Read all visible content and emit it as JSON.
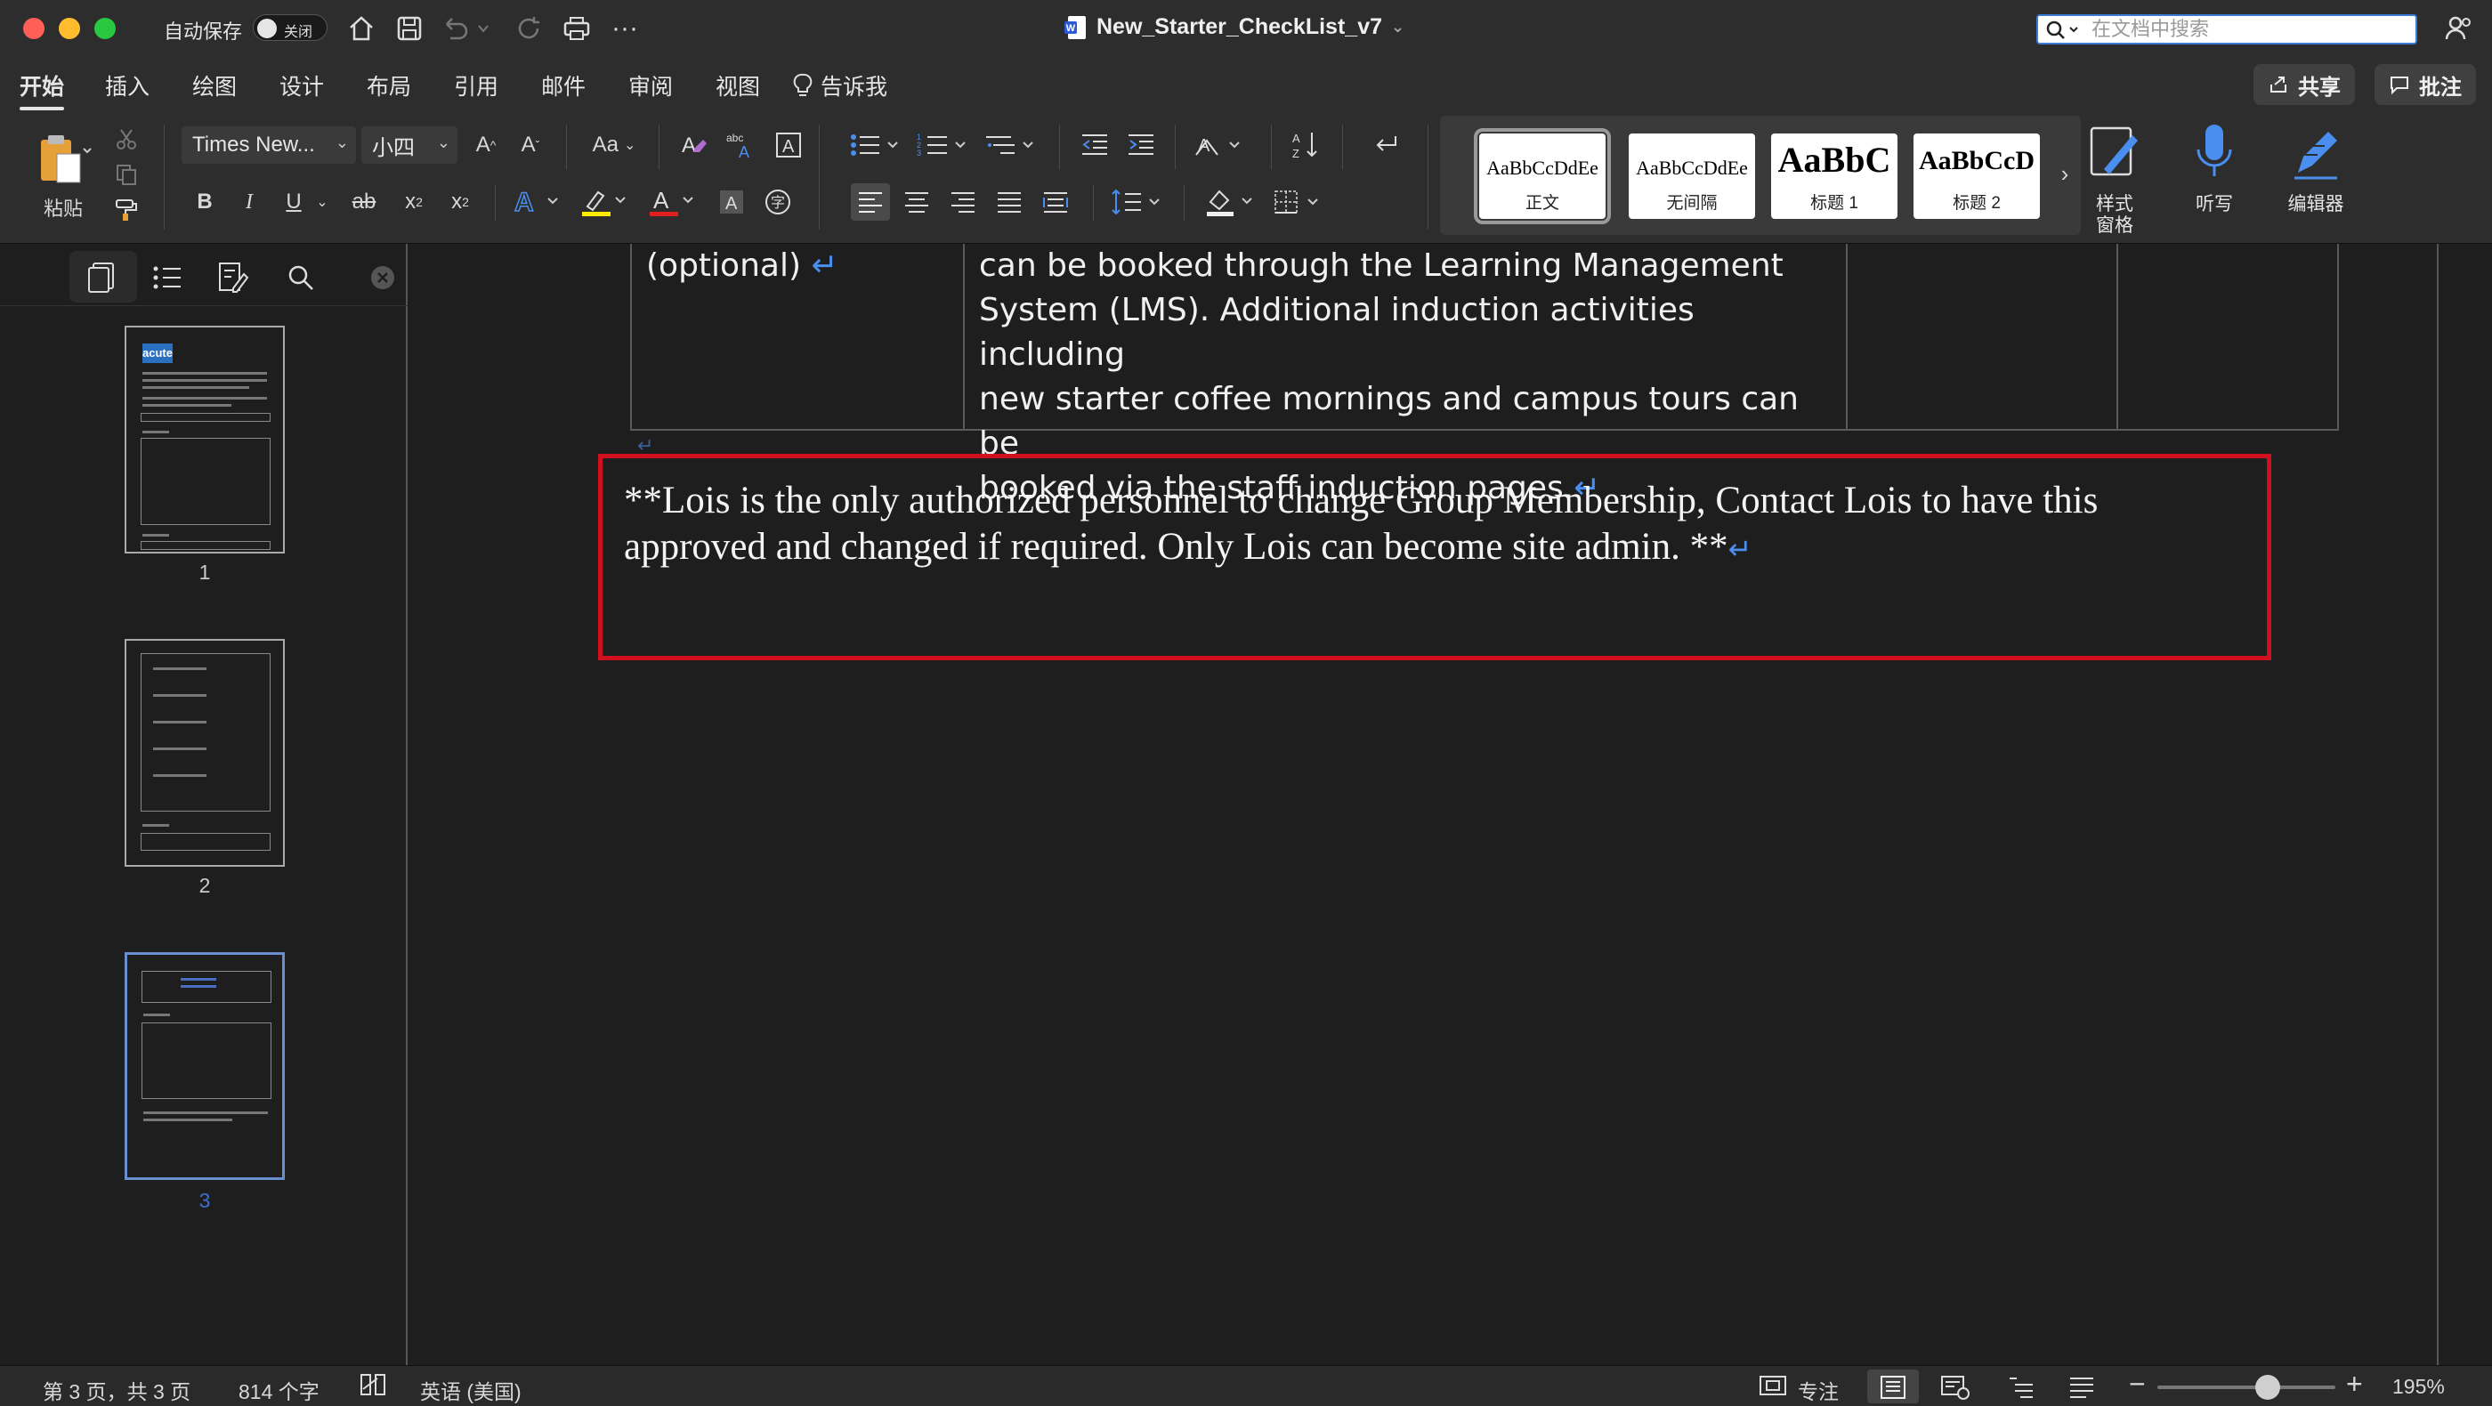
{
  "window": {
    "autosave_label": "自动保存",
    "autosave_state": "关闭",
    "doc_title": "New_Starter_CheckList_v7",
    "search_placeholder": "在文档中搜索"
  },
  "ribbon_tabs": [
    "开始",
    "插入",
    "绘图",
    "设计",
    "布局",
    "引用",
    "邮件",
    "审阅",
    "视图"
  ],
  "tell_me": "告诉我",
  "share_label": "共享",
  "comments_label": "批注",
  "ribbon": {
    "paste_label": "粘贴",
    "font_name": "Times New...",
    "font_size": "小四",
    "change_case": "Aa",
    "styles": [
      {
        "preview": "AaBbCcDdEe",
        "name": "正文"
      },
      {
        "preview": "AaBbCcDdEe",
        "name": "无间隔"
      },
      {
        "preview": "AaBbC",
        "name": "标题 1"
      },
      {
        "preview": "AaBbCcD",
        "name": "标题 2"
      }
    ],
    "styles_pane_label": "样式\n窗格",
    "dictate_label": "听写",
    "editor_label": "编辑器",
    "colors": {
      "highlight": "#ffeb00",
      "font_color": "#e02020",
      "accent": "#3a7bd5"
    }
  },
  "nav": {
    "pages": [
      "1",
      "2",
      "3"
    ],
    "selected_page": "3",
    "thumb1_logo": "acute"
  },
  "document": {
    "table_cell_left": "(optional) ",
    "table_cell_middle": [
      "can be booked through the Learning Management",
      "System (LMS). Additional induction activities including",
      "new starter coffee mornings and campus tours can be",
      "booked via the staff induction pages."
    ],
    "note_lines": [
      "**Lois is the only authorized personnel to change Group Membership, Contact Lois to have this",
      "approved and changed if required. Only Lois can become site admin. **"
    ],
    "para_mark": "↵"
  },
  "status": {
    "page_info": "第 3 页，共 3 页",
    "word_count": "814 个字",
    "language": "英语 (美国)",
    "focus_label": "专注",
    "zoom_level": "195%",
    "zoom_fraction": 0.62
  }
}
